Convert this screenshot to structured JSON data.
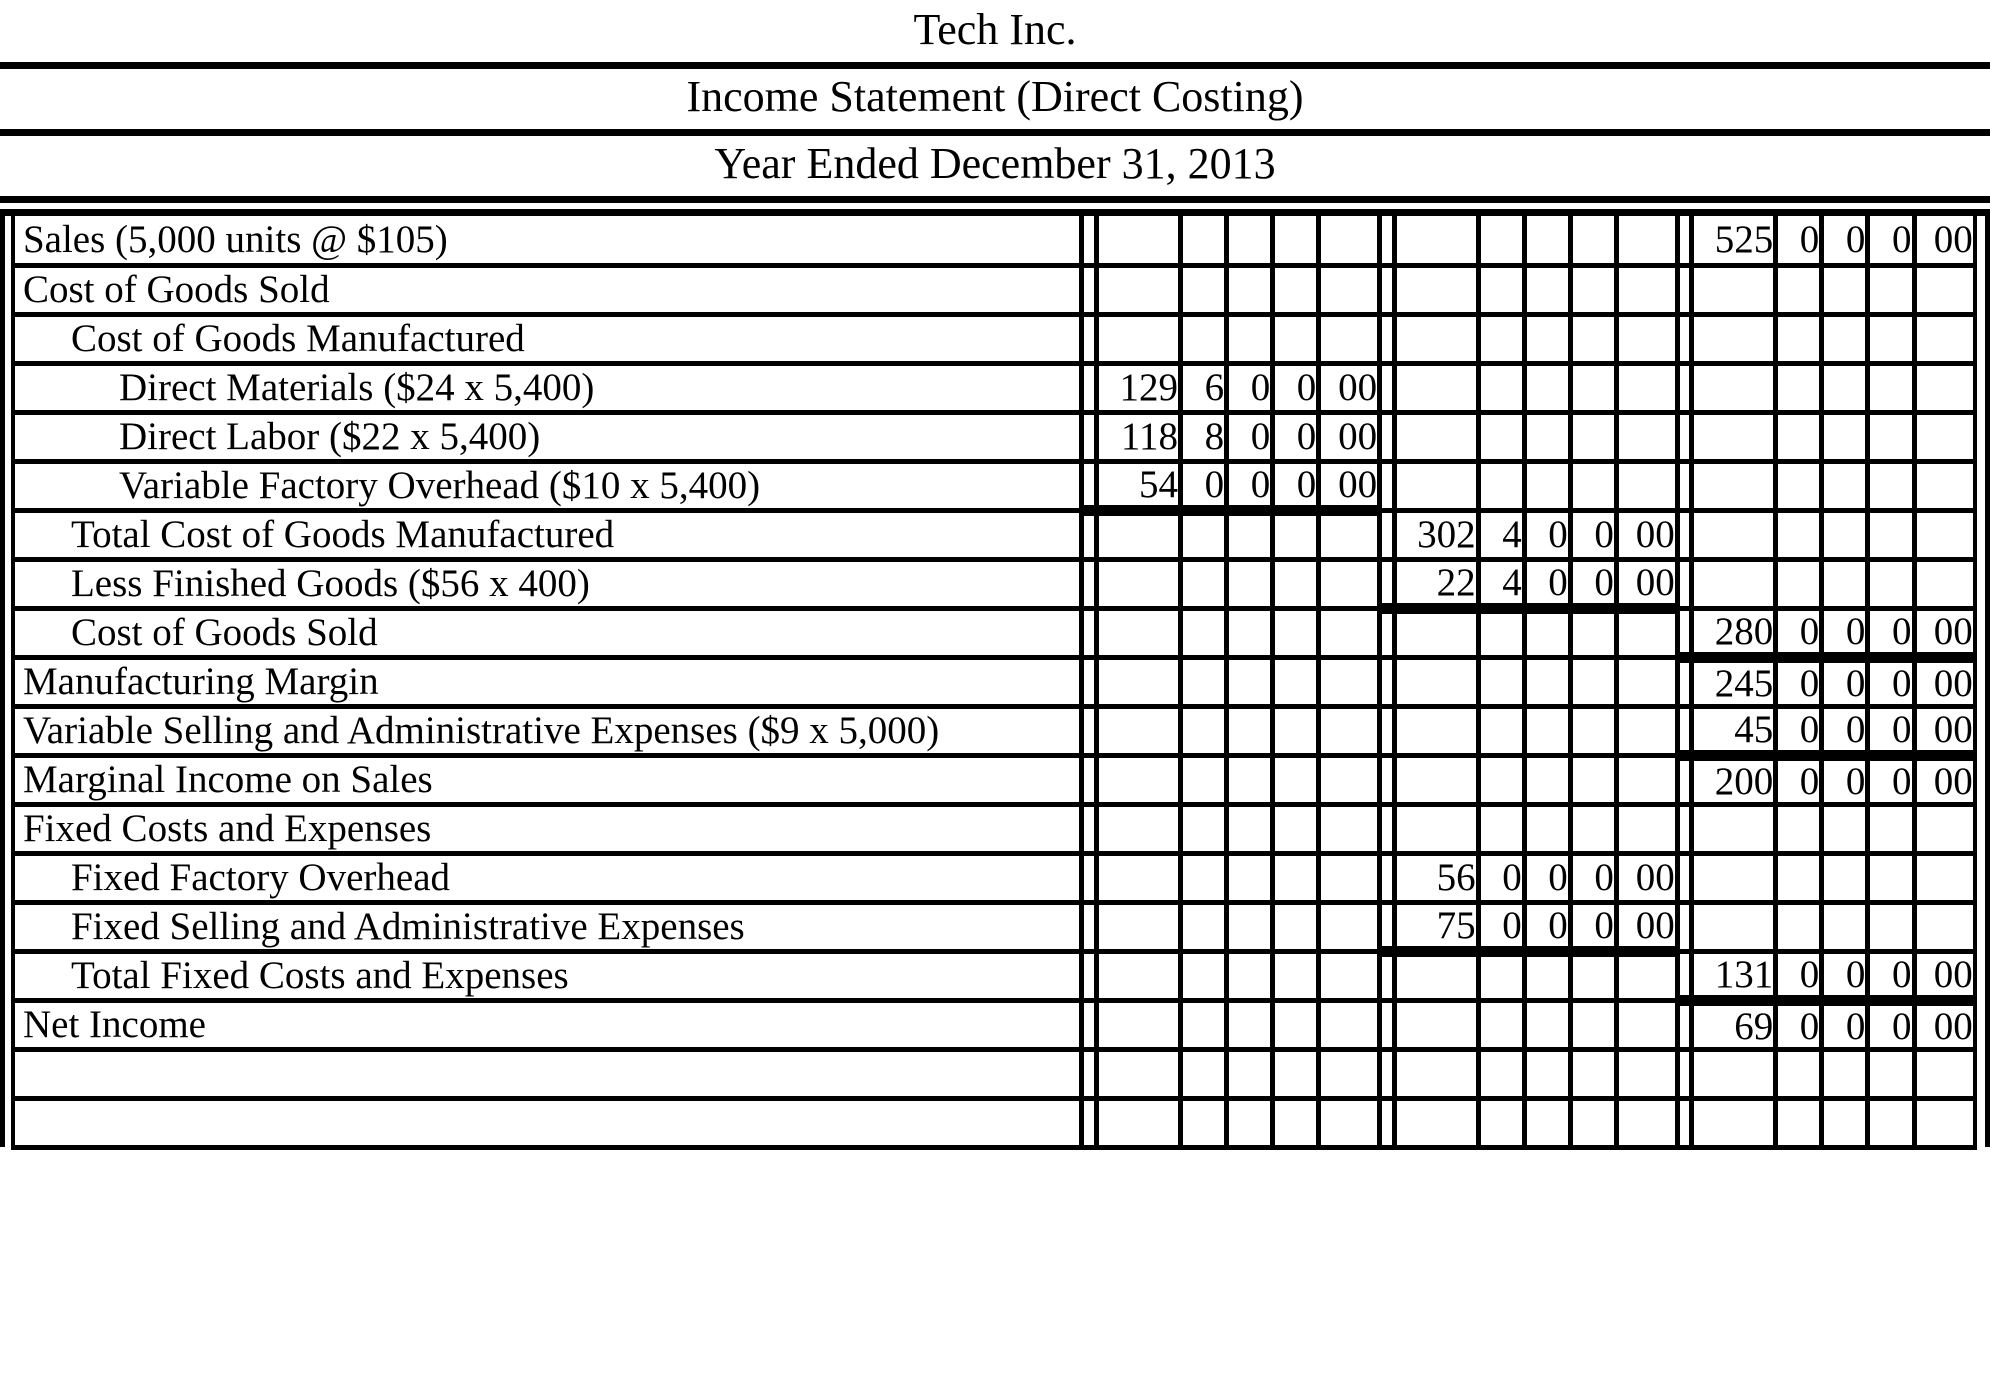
{
  "document": {
    "company": "Tech Inc.",
    "statement_title": "Income Statement (Direct Costing)",
    "period": "Year Ended December 31, 2013"
  },
  "columns": {
    "group_count": 3,
    "cells_per_group": 5,
    "cell_kinds": [
      "thousands",
      "hundreds",
      "tens",
      "ones",
      "cents"
    ]
  },
  "rows": [
    {
      "label": "Sales (5,000 units @ $105)",
      "indent": 0,
      "g1": [
        "",
        "",
        "",
        "",
        ""
      ],
      "g2": [
        "",
        "",
        "",
        "",
        ""
      ],
      "g3": [
        "525",
        "0",
        "0",
        "0",
        "00"
      ],
      "rule": "none"
    },
    {
      "label": "Cost of Goods Sold",
      "indent": 0,
      "g1": [
        "",
        "",
        "",
        "",
        ""
      ],
      "g2": [
        "",
        "",
        "",
        "",
        ""
      ],
      "g3": [
        "",
        "",
        "",
        "",
        ""
      ],
      "rule": "none"
    },
    {
      "label": "Cost of Goods Manufactured",
      "indent": 1,
      "g1": [
        "",
        "",
        "",
        "",
        ""
      ],
      "g2": [
        "",
        "",
        "",
        "",
        ""
      ],
      "g3": [
        "",
        "",
        "",
        "",
        ""
      ],
      "rule": "none"
    },
    {
      "label": "Direct Materials ($24 x 5,400)",
      "indent": 2,
      "g1": [
        "129",
        "6",
        "0",
        "0",
        "00"
      ],
      "g2": [
        "",
        "",
        "",
        "",
        ""
      ],
      "g3": [
        "",
        "",
        "",
        "",
        ""
      ],
      "rule": "none"
    },
    {
      "label": "Direct Labor ($22 x 5,400)",
      "indent": 2,
      "g1": [
        "118",
        "8",
        "0",
        "0",
        "00"
      ],
      "g2": [
        "",
        "",
        "",
        "",
        ""
      ],
      "g3": [
        "",
        "",
        "",
        "",
        ""
      ],
      "rule": "none"
    },
    {
      "label": "Variable Factory Overhead ($10 x 5,400)",
      "indent": 2,
      "g1": [
        "54",
        "0",
        "0",
        "0",
        "00"
      ],
      "g2": [
        "",
        "",
        "",
        "",
        ""
      ],
      "g3": [
        "",
        "",
        "",
        "",
        ""
      ],
      "rule": "subtotal-g1"
    },
    {
      "label": "Total Cost of Goods Manufactured",
      "indent": 1,
      "g1": [
        "",
        "",
        "",
        "",
        ""
      ],
      "g2": [
        "302",
        "4",
        "0",
        "0",
        "00"
      ],
      "g3": [
        "",
        "",
        "",
        "",
        ""
      ],
      "rule": "none"
    },
    {
      "label": "Less Finished Goods ($56 x 400)",
      "indent": 1,
      "g1": [
        "",
        "",
        "",
        "",
        ""
      ],
      "g2": [
        "22",
        "4",
        "0",
        "0",
        "00"
      ],
      "g3": [
        "",
        "",
        "",
        "",
        ""
      ],
      "rule": "subtotal-g2"
    },
    {
      "label": "Cost of Goods Sold",
      "indent": 1,
      "g1": [
        "",
        "",
        "",
        "",
        ""
      ],
      "g2": [
        "",
        "",
        "",
        "",
        ""
      ],
      "g3": [
        "280",
        "0",
        "0",
        "0",
        "00"
      ],
      "rule": "subtotal-g3"
    },
    {
      "label": "Manufacturing Margin",
      "indent": 0,
      "g1": [
        "",
        "",
        "",
        "",
        ""
      ],
      "g2": [
        "",
        "",
        "",
        "",
        ""
      ],
      "g3": [
        "245",
        "0",
        "0",
        "0",
        "00"
      ],
      "rule": "none"
    },
    {
      "label": "Variable Selling and Administrative Expenses ($9 x 5,000)",
      "indent": 0,
      "g1": [
        "",
        "",
        "",
        "",
        ""
      ],
      "g2": [
        "",
        "",
        "",
        "",
        ""
      ],
      "g3": [
        "45",
        "0",
        "0",
        "0",
        "00"
      ],
      "rule": "subtotal-g3"
    },
    {
      "label": "Marginal Income on Sales",
      "indent": 0,
      "g1": [
        "",
        "",
        "",
        "",
        ""
      ],
      "g2": [
        "",
        "",
        "",
        "",
        ""
      ],
      "g3": [
        "200",
        "0",
        "0",
        "0",
        "00"
      ],
      "rule": "none"
    },
    {
      "label": "Fixed Costs and Expenses",
      "indent": 0,
      "g1": [
        "",
        "",
        "",
        "",
        ""
      ],
      "g2": [
        "",
        "",
        "",
        "",
        ""
      ],
      "g3": [
        "",
        "",
        "",
        "",
        ""
      ],
      "rule": "none"
    },
    {
      "label": "Fixed Factory Overhead",
      "indent": 1,
      "g1": [
        "",
        "",
        "",
        "",
        ""
      ],
      "g2": [
        "56",
        "0",
        "0",
        "0",
        "00"
      ],
      "g3": [
        "",
        "",
        "",
        "",
        ""
      ],
      "rule": "none"
    },
    {
      "label": "Fixed Selling and Administrative Expenses",
      "indent": 1,
      "g1": [
        "",
        "",
        "",
        "",
        ""
      ],
      "g2": [
        "75",
        "0",
        "0",
        "0",
        "00"
      ],
      "g3": [
        "",
        "",
        "",
        "",
        ""
      ],
      "rule": "subtotal-g2"
    },
    {
      "label": "Total Fixed Costs and Expenses",
      "indent": 1,
      "g1": [
        "",
        "",
        "",
        "",
        ""
      ],
      "g2": [
        "",
        "",
        "",
        "",
        ""
      ],
      "g3": [
        "131",
        "0",
        "0",
        "0",
        "00"
      ],
      "rule": "subtotal-g3"
    },
    {
      "label": "Net Income",
      "indent": 0,
      "g1": [
        "",
        "",
        "",
        "",
        ""
      ],
      "g2": [
        "",
        "",
        "",
        "",
        ""
      ],
      "g3": [
        "69",
        "0",
        "0",
        "0",
        "00"
      ],
      "rule": "double-g3"
    },
    {
      "label": "",
      "indent": 0,
      "g1": [
        "",
        "",
        "",
        "",
        ""
      ],
      "g2": [
        "",
        "",
        "",
        "",
        ""
      ],
      "g3": [
        "",
        "",
        "",
        "",
        ""
      ],
      "rule": "none"
    },
    {
      "label": "",
      "indent": 0,
      "g1": [
        "",
        "",
        "",
        "",
        ""
      ],
      "g2": [
        "",
        "",
        "",
        "",
        ""
      ],
      "g3": [
        "",
        "",
        "",
        "",
        ""
      ],
      "rule": "none"
    }
  ]
}
